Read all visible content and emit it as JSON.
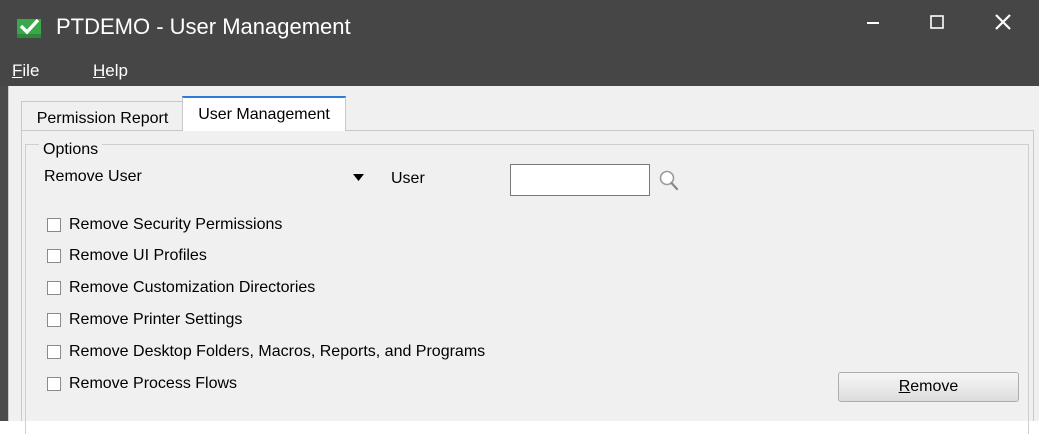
{
  "window": {
    "title": "PTDEMO - User Management",
    "accent_color": "#2b7dd7",
    "app_icon": "checkmark-app-icon"
  },
  "menu": {
    "file": {
      "mnemonic": "F",
      "rest": "ile"
    },
    "help": {
      "mnemonic": "H",
      "rest": "elp"
    }
  },
  "tabs": [
    {
      "label": "Permission Report",
      "active": false
    },
    {
      "label": "User Management",
      "active": true
    }
  ],
  "options": {
    "group_label": "Options",
    "action_select": {
      "value": "Remove User"
    },
    "user_label": "User",
    "user_input": {
      "value": ""
    },
    "search_icon": "magnifier-icon",
    "checkboxes": [
      {
        "label": "Remove Security Permissions",
        "checked": false
      },
      {
        "label": "Remove UI Profiles",
        "checked": false
      },
      {
        "label": "Remove Customization Directories",
        "checked": false
      },
      {
        "label": "Remove Printer Settings",
        "checked": false
      },
      {
        "label": "Remove Desktop Folders, Macros, Reports, and Programs",
        "checked": false
      },
      {
        "label": "Remove Process Flows",
        "checked": false
      }
    ],
    "remove_button": {
      "mnemonic": "R",
      "rest": "emove"
    }
  }
}
